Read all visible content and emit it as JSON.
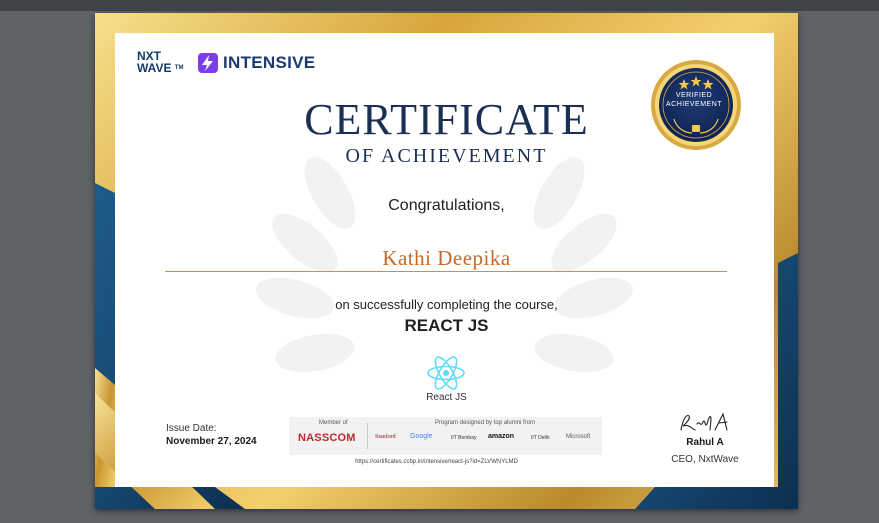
{
  "brand": {
    "nxtwave_line1": "NXT",
    "nxtwave_line2": "WAVE",
    "nxtwave_tm": "TM",
    "intensive": "INTENSIVE"
  },
  "certificate": {
    "title": "CERTIFICATE",
    "subtitle": "OF ACHIEVEMENT",
    "congrats": "Congratulations,",
    "recipient": "Kathi Deepika",
    "course_intro": "on successfully completing the course,",
    "course": "REACT JS",
    "tech_label": "React JS",
    "issue_label": "Issue Date:",
    "issue_date": "November 27, 2024",
    "verify_url": "https://certificates.ccbp.in/intensive/react-js?id=ZLVWNYLMD"
  },
  "badge": {
    "line1": "VERIFIED",
    "line2": "ACHIEVEMENT"
  },
  "partners": {
    "member_of": "Member of",
    "nasscom": "NASSCOM",
    "program": "Program designed by top alumni from",
    "stanford": "Stanford",
    "google": "Google",
    "iit_bombay": "IIT Bombay",
    "amazon": "amazon",
    "iit_delhi": "IIT Delhi",
    "microsoft": "Microsoft"
  },
  "signatory": {
    "signature": "Rahul A",
    "name": "Rahul A",
    "role": "CEO, NxtWave"
  },
  "colors": {
    "navy": "#1b2f55",
    "gold": "#d7a63b",
    "accent_name": "#c46a2c",
    "react": "#61dafb"
  }
}
